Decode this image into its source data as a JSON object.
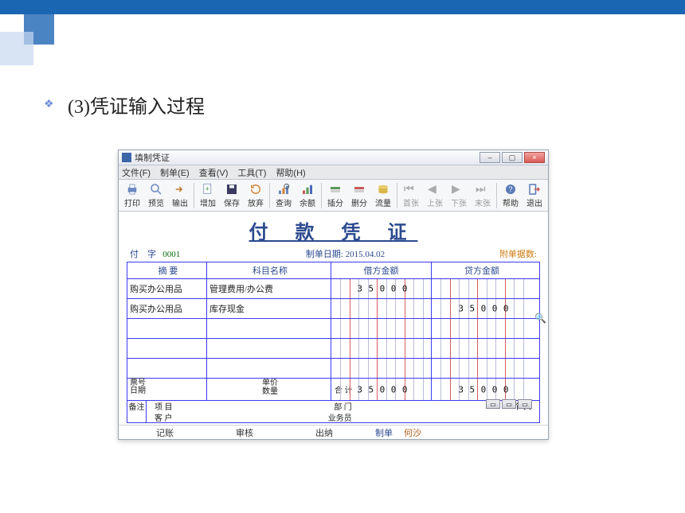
{
  "heading": "(3)凭证输入过程",
  "window": {
    "title": "填制凭证",
    "buttons": {
      "min": "–",
      "max": "▢",
      "close": "×"
    }
  },
  "menu": {
    "file": "文件(F)",
    "make": "制单(E)",
    "view": "查看(V)",
    "tool": "工具(T)",
    "help": "帮助(H)"
  },
  "toolbar": {
    "print": "打印",
    "preview": "预览",
    "output": "输出",
    "add": "增加",
    "save": "保存",
    "discard": "放弃",
    "query": "查询",
    "balance": "余额",
    "insert": "插分",
    "cut": "删分",
    "flow": "流量",
    "first": "首张",
    "prev": "上张",
    "next": "下张",
    "last": "末张",
    "helpbtn": "帮助",
    "exit": "退出"
  },
  "voucher": {
    "title": "付 款 凭 证",
    "type_label": "付",
    "type_word": "字",
    "number": "0001",
    "date_label": "制单日期:",
    "date_value": "2015.04.02",
    "attach_label": "附单据数:",
    "head": {
      "summary": "摘  要",
      "subject": "科目名称",
      "debit": "借方金额",
      "credit": "贷方金额"
    },
    "rows": [
      {
        "summary": "购买办公用品",
        "subject": "管理费用/办公费",
        "debit": "35000",
        "credit": ""
      },
      {
        "summary": "购买办公用品",
        "subject": "库存现金",
        "debit": "",
        "credit": "35000"
      },
      {
        "summary": "",
        "subject": "",
        "debit": "",
        "credit": ""
      },
      {
        "summary": "",
        "subject": "",
        "debit": "",
        "credit": ""
      },
      {
        "summary": "",
        "subject": "",
        "debit": "",
        "credit": ""
      }
    ],
    "sum": {
      "ticket": "票号",
      "date": "日期",
      "price": "单价",
      "qty": "数量",
      "total_label": "合  计",
      "debit_total": "35000",
      "credit_total": "35000"
    },
    "notes": {
      "label": "备注",
      "project": "项  目",
      "dept": "部  门",
      "person": "个  人",
      "customer": "客  户",
      "bizman": "业务员"
    }
  },
  "status": {
    "book": "记账",
    "audit": "审核",
    "cash": "出纳",
    "maker_label": "制单",
    "maker": "何沙"
  }
}
